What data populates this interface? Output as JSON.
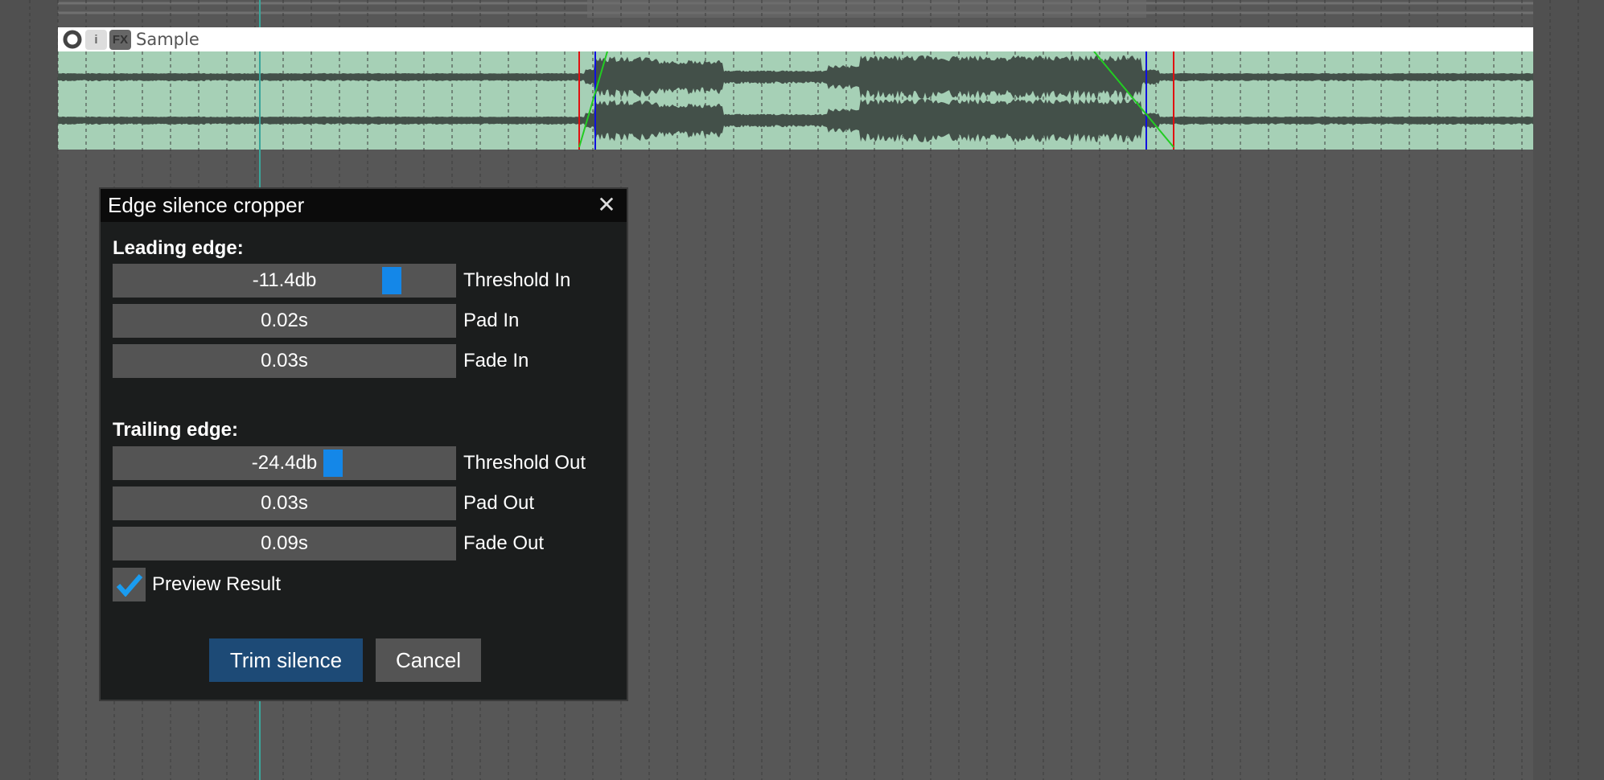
{
  "track": {
    "name": "Sample",
    "icons": [
      "phase-icon",
      "info-icon",
      "fx-icon"
    ],
    "fx_label": "FX",
    "info_label": "i"
  },
  "colors": {
    "waveform_bg": "#a6d0b6",
    "waveform": "#435049",
    "trim_marker": "#e01010",
    "content_marker": "#1010e0",
    "fade_line": "#22cc22",
    "playhead": "#3aa59a",
    "accent": "#1487e8",
    "primary_button": "#1d4a76"
  },
  "dialog": {
    "title": "Edge silence cropper",
    "leading_label": "Leading edge:",
    "trailing_label": "Trailing edge:",
    "leading": [
      {
        "value": "-11.4db",
        "label": "Threshold In",
        "slider": true
      },
      {
        "value": "0.02s",
        "label": "Pad In"
      },
      {
        "value": "0.03s",
        "label": "Fade In"
      }
    ],
    "trailing": [
      {
        "value": "-24.4db",
        "label": "Threshold Out",
        "slider": true
      },
      {
        "value": "0.03s",
        "label": "Pad Out"
      },
      {
        "value": "0.09s",
        "label": "Fade Out"
      }
    ],
    "preview": {
      "label": "Preview Result",
      "checked": true
    },
    "trim_button": "Trim silence",
    "cancel_button": "Cancel"
  }
}
